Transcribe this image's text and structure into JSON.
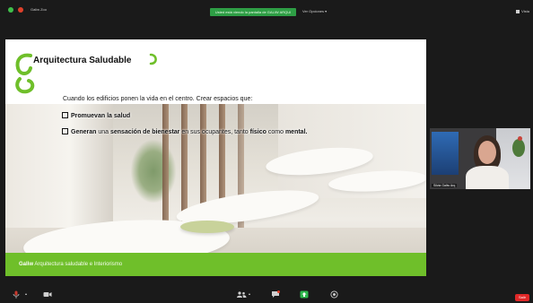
{
  "top_bar": {
    "meeting_label": "Galiw Zoo",
    "sharing_banner": "Usted está viendo la pantalla de GALIW ARQUI",
    "view_options": "Ver Opciones",
    "view_right": "Vista"
  },
  "slide": {
    "title": "Arquitectura Saludable",
    "intro": "Cuando los edificios ponen la vida en el centro. Crear espacios que:",
    "bullet1_bold": "Promuevan la salud",
    "bullet2_a": "Generan",
    "bullet2_b": " una ",
    "bullet2_c": "sensación de bienestar",
    "bullet2_d": " en sus ocupantes, tanto ",
    "bullet2_e": "físico",
    "bullet2_f": " como ",
    "bullet2_g": "mental.",
    "footer_brand": "Galiw",
    "footer_text": " Arquitectura saludable e Interiorismo"
  },
  "participant": {
    "name": "Silvia Galiw Arq"
  },
  "bottom_bar": {
    "leave": "Salir"
  },
  "colors": {
    "brand_green": "#6fbf2a",
    "banner_green": "#2e9e45",
    "leave_red": "#e02828"
  },
  "icons": [
    "microphone-icon",
    "camera-icon",
    "participants-icon",
    "chat-icon",
    "share-icon",
    "record-icon"
  ]
}
